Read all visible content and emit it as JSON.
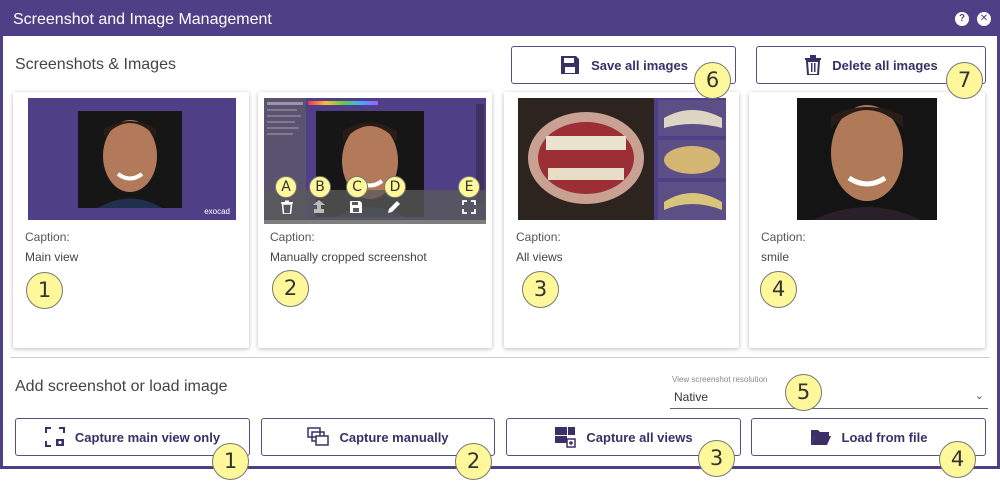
{
  "window": {
    "title": "Screenshot and Image Management",
    "help_icon": "question-circle-icon",
    "close_icon": "close-circle-icon"
  },
  "images_section": {
    "title": "Screenshots & Images",
    "save_all_label": "Save all images",
    "delete_all_label": "Delete all images"
  },
  "cards": [
    {
      "caption_label": "Caption:",
      "caption": "Main view",
      "watermark": "exocad"
    },
    {
      "caption_label": "Caption:",
      "caption": "Manually cropped screenshot"
    },
    {
      "caption_label": "Caption:",
      "caption": "All views"
    },
    {
      "caption_label": "Caption:",
      "caption": "smile"
    }
  ],
  "card_actions": [
    "trash-icon",
    "upload-icon",
    "save-icon",
    "pencil-icon",
    "fullscreen-icon"
  ],
  "add_section": {
    "title": "Add screenshot or load image",
    "resolution_label": "View screenshot resolution",
    "resolution_value": "Native",
    "capture_main_label": "Capture main view only",
    "capture_manual_label": "Capture manually",
    "capture_all_label": "Capture all views",
    "load_file_label": "Load from file"
  },
  "callouts": {
    "card1": "1",
    "card2": "2",
    "card3": "3",
    "card4": "4",
    "resolution": "5",
    "save_all": "6",
    "delete_all": "7",
    "btn1": "1",
    "btn2": "2",
    "btn3": "3",
    "btn4": "4",
    "a": "A",
    "b": "B",
    "c": "C",
    "d": "D",
    "e": "E"
  },
  "colors": {
    "accent": "#4f3f86",
    "callout_fill": "#fff89a",
    "thumb_background": "#4f3f86"
  }
}
